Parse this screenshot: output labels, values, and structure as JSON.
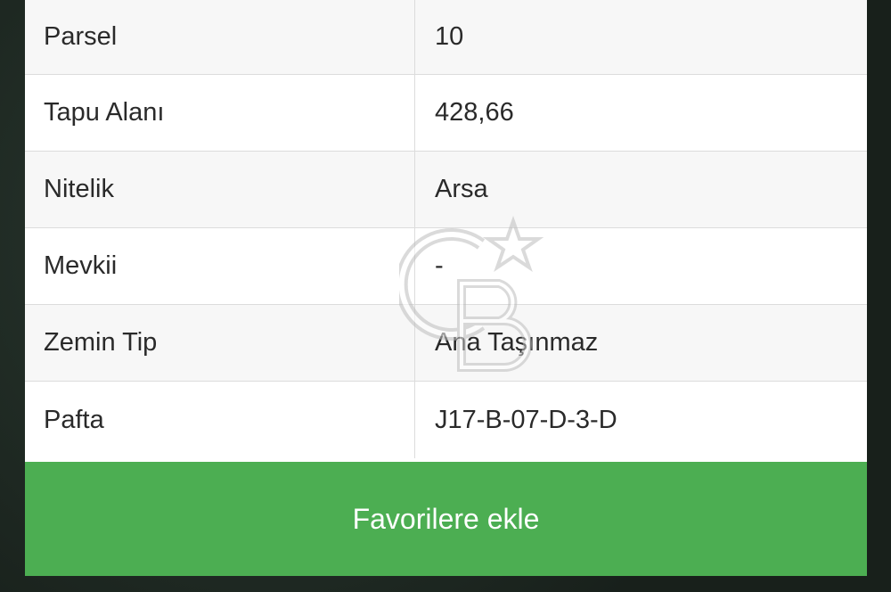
{
  "details": {
    "rows": [
      {
        "label": "Parsel",
        "value": "10"
      },
      {
        "label": "Tapu Alanı",
        "value": "428,66"
      },
      {
        "label": "Nitelik",
        "value": "Arsa"
      },
      {
        "label": "Mevkii",
        "value": "-"
      },
      {
        "label": "Zemin Tip",
        "value": "Ana Taşınmaz"
      },
      {
        "label": "Pafta",
        "value": "J17-B-07-D-3-D"
      }
    ]
  },
  "actions": {
    "favorite_label": "Favorilere ekle"
  },
  "colors": {
    "button_green": "#4cae52",
    "row_alt": "#f7f7f7",
    "text": "#2a2a2a"
  },
  "icons": {
    "watermark": "cb-star-logo-watermark"
  }
}
